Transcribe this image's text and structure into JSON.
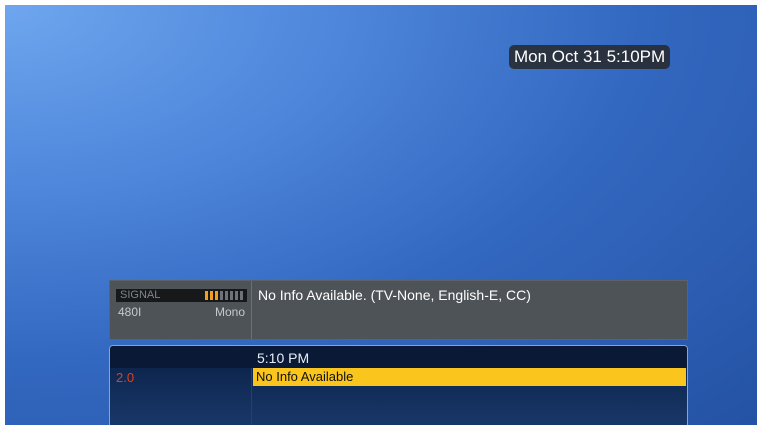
{
  "clock": {
    "datetime": "Mon Oct 31 5:10PM"
  },
  "info_banner": {
    "signal_label": "SIGNAL",
    "signal_strength": {
      "active_bars": 3,
      "total_bars": 8
    },
    "resolution": "480I",
    "audio": "Mono",
    "program_info": "No Info Available. (TV-None, English-E, CC)"
  },
  "guide": {
    "time_slot": "5:10 PM",
    "channel": "2.0",
    "program_title": "No Info Available"
  },
  "colors": {
    "signal_active": "#f0a020",
    "channel_number": "#e0401c",
    "program_highlight": "#fac51c"
  }
}
